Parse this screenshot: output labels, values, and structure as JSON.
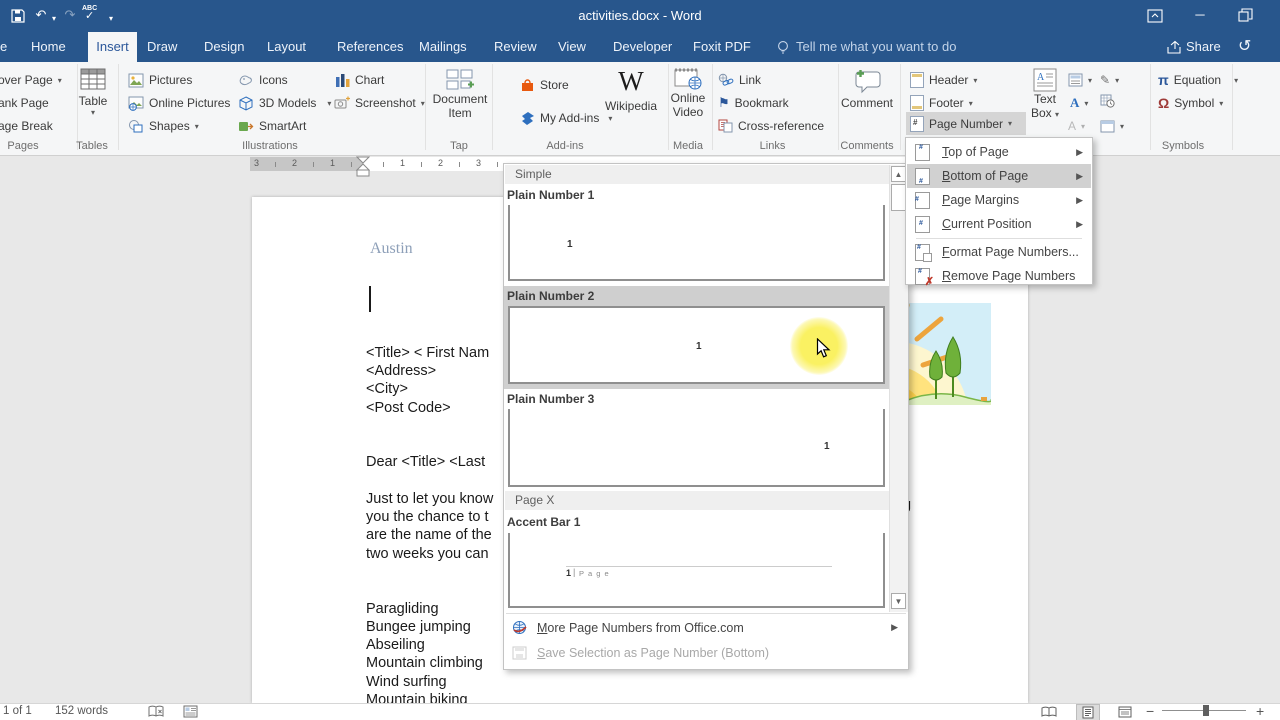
{
  "colors": {
    "titlebar_blue": "#28568c",
    "accent_blue": "#2b579a",
    "highlight_yellow": "#faf05a",
    "menu_highlight": "#d1d1d1",
    "page_bg": "#ffffff",
    "canvas_bg": "#e8e8e8"
  },
  "titlebar": {
    "title": "activities.docx - Word"
  },
  "tabs": {
    "file_fragment": "e",
    "items": [
      "Home",
      "Insert",
      "Draw",
      "Design",
      "Layout",
      "References",
      "Mailings",
      "Review",
      "View",
      "Developer",
      "Foxit PDF"
    ],
    "active": "Insert",
    "tell_me": "Tell me what you want to do",
    "share": "Share"
  },
  "glyphs": {
    "dropdown": "▾",
    "submenu": "▶",
    "up": "▲",
    "down": "▼",
    "undo": "↶",
    "redo": "↷",
    "check": "✓",
    "abc": "ABC",
    "pi": "π",
    "omega": "Ω",
    "flag": "⚑",
    "minus": "−",
    "plus": "+",
    "minimize": "─",
    "history": "↺",
    "pen": "✎",
    "a": "A",
    "w": "W",
    "hash": "#",
    "x": "✗",
    "caret": "ˆ"
  },
  "ribbon": {
    "cover_page": "over Page",
    "blank_page": "ank Page",
    "page_break": "age Break",
    "pages_label": "Pages",
    "table": "Table",
    "tables_label": "Tables",
    "pictures": "Pictures",
    "online_pictures": "Online Pictures",
    "shapes": "Shapes",
    "icons": "Icons",
    "models_3d": "3D Models",
    "smartart": "SmartArt",
    "chart": "Chart",
    "screenshot": "Screenshot",
    "illustrations_label": "Illustrations",
    "doc_item_1": "Document",
    "doc_item_2": "Item",
    "tap_label": "Tap",
    "store": "Store",
    "my_addins": "My Add-ins",
    "wikipedia": "Wikipedia",
    "addins_label": "Add-ins",
    "online_1": "Online",
    "online_2": "Video",
    "media_label": "Media",
    "link": "Link",
    "bookmark": "Bookmark",
    "cross_reference": "Cross-reference",
    "links_label": "Links",
    "comment": "Comment",
    "comments_label": "Comments",
    "header": "Header",
    "footer": "Footer",
    "page_number": "Page Number",
    "text_1": "Text",
    "text_2": "Box",
    "equation": "Equation",
    "symbol": "Symbol",
    "symbols_label": "Symbols"
  },
  "page_number_menu": {
    "items": [
      {
        "key": "T",
        "rest": "op of Page"
      },
      {
        "key": "B",
        "rest": "ottom of Page"
      },
      {
        "key": "P",
        "rest": "age Margins"
      },
      {
        "key": "C",
        "rest": "urrent Position"
      },
      {
        "key": "F",
        "rest": "ormat Page Numbers..."
      },
      {
        "key": "R",
        "rest": "emove Page Numbers"
      }
    ]
  },
  "gallery": {
    "section_simple": "Simple",
    "plain1": "Plain Number 1",
    "plain2": "Plain Number 2",
    "plain3": "Plain Number 3",
    "section_pagex": "Page X",
    "accent1": "Accent Bar 1",
    "preview_number": "1",
    "accent_num": "1",
    "accent_sep": "|",
    "accent_word": "P a g e",
    "more_key": "M",
    "more_rest": "ore Page Numbers from Office.com",
    "save_key": "S",
    "save_rest": "ave Selection as Page Number (Bottom)"
  },
  "document": {
    "heading": "Austin",
    "address_lines": [
      "<Title> < First Nam",
      "<Address>",
      "<City>",
      "<Post Code>"
    ],
    "salutation": "Dear <Title> <Last",
    "body_lines": [
      "Just to let you know",
      "you the chance to t",
      "are the name of the",
      "two weeks you can"
    ],
    "activities": [
      "Paragliding",
      "Bungee jumping",
      "Abseiling",
      "Mountain climbing",
      "Wind surfing",
      "Mountain biking"
    ],
    "edge_fragment": "g"
  },
  "ruler": {
    "left": [
      "3",
      "2",
      "1"
    ],
    "right": [
      "1",
      "2",
      "3"
    ]
  },
  "status": {
    "page": "1 of 1",
    "words": "152 words"
  }
}
